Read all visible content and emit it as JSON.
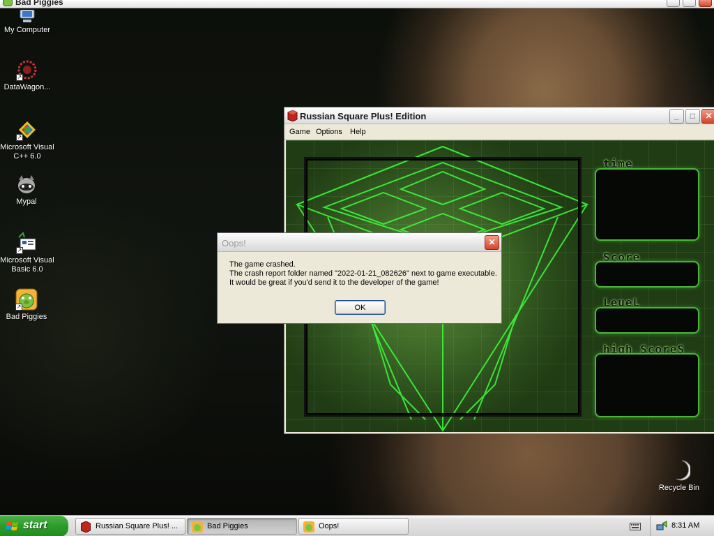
{
  "top_window": {
    "title": "Bad Piggies"
  },
  "desktop_icons": [
    {
      "label": "My Computer",
      "icon": "my-computer-icon"
    },
    {
      "label": "DataWagon...",
      "icon": "datawagon-icon"
    },
    {
      "label": "Microsoft Visual C++ 6.0",
      "icon": "visual-cpp-icon"
    },
    {
      "label": "Mypal",
      "icon": "mypal-icon"
    },
    {
      "label": "Microsoft Visual Basic 6.0",
      "icon": "visual-basic-icon"
    },
    {
      "label": "Bad Piggies",
      "icon": "bad-piggies-icon"
    },
    {
      "label": "Recycle Bin",
      "icon": "recycle-bin-icon"
    }
  ],
  "game_window": {
    "title": "Russian Square Plus! Edition",
    "menu": [
      "Game",
      "Options",
      "Help"
    ],
    "panels": {
      "time_label": "time",
      "score_label": "Score",
      "level_label": "LeueL",
      "high_scores_label": "high ScoreS"
    },
    "accent_color": "#4db33d"
  },
  "dialog": {
    "title": "Oops!",
    "line1": "The game crashed.",
    "line2": "The crash report folder named \"2022-01-21_082626\" next to game executable.",
    "line3": "It would be great if you'd send it to the developer of the game!",
    "ok_label": "OK"
  },
  "taskbar": {
    "start_label": "start",
    "tasks": [
      {
        "label": "Russian Square Plus! ...",
        "icon": "russian-square-icon"
      },
      {
        "label": "Bad Piggies",
        "icon": "bad-piggies-icon"
      },
      {
        "label": "Oops!",
        "icon": "bad-piggies-icon"
      }
    ],
    "clock": "8:31 AM"
  }
}
